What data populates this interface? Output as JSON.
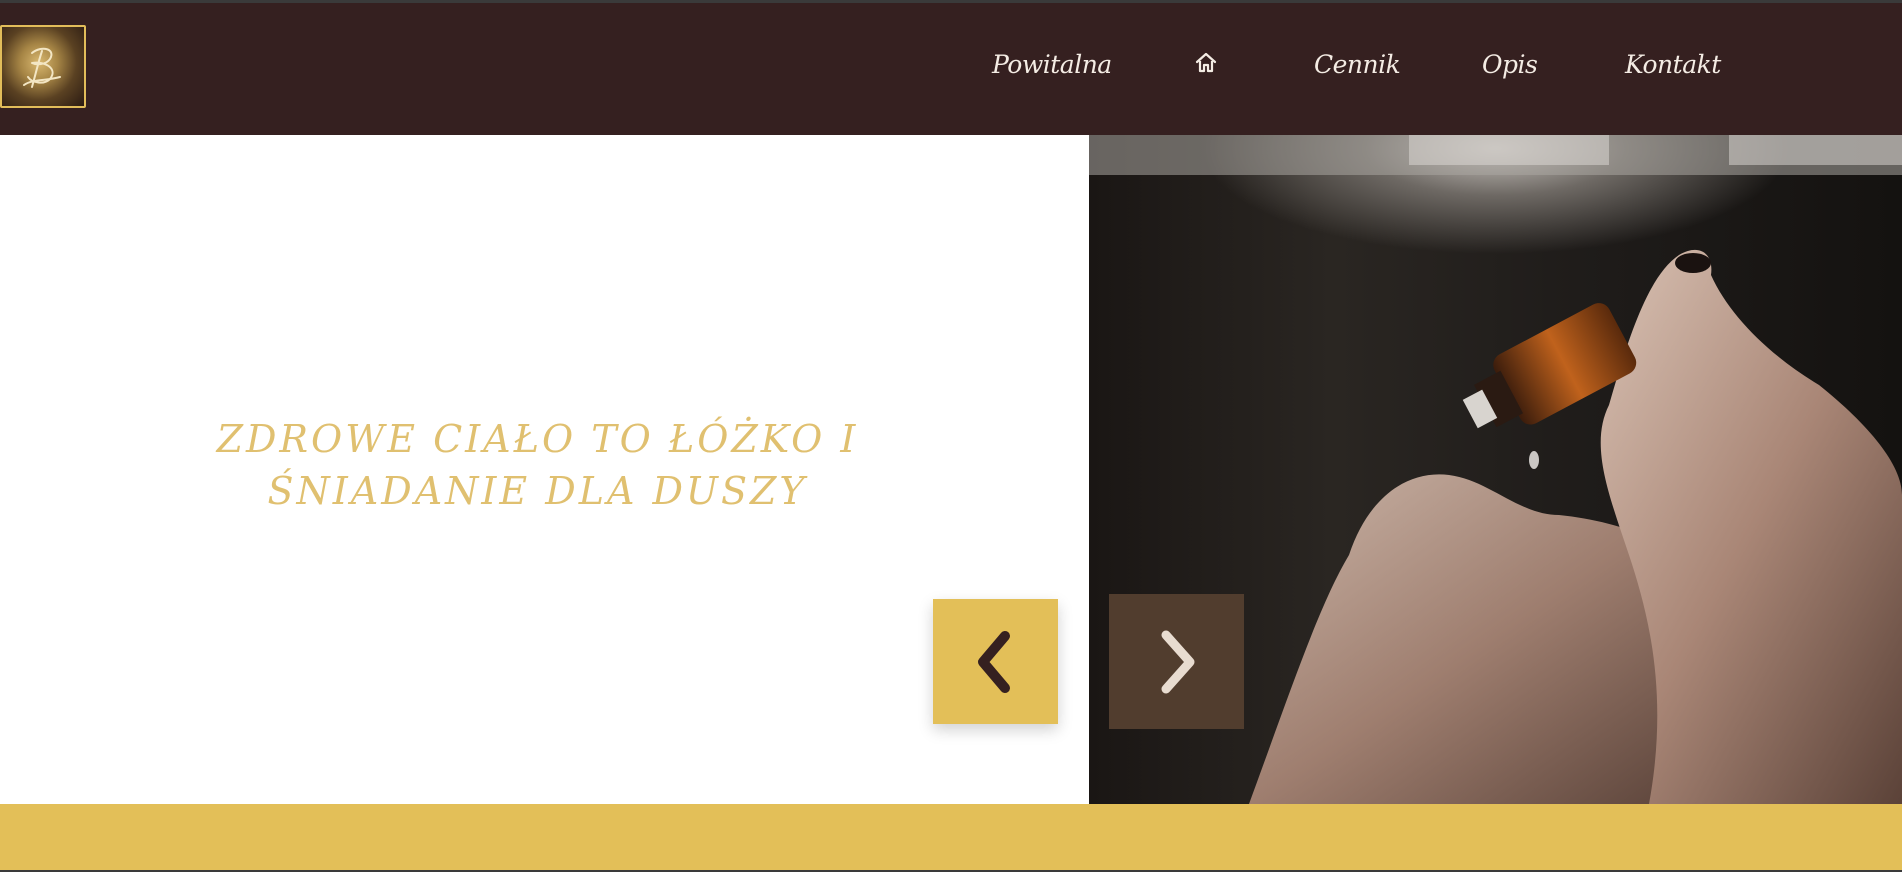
{
  "header": {
    "logo_icon": "monogram-logo",
    "nav": {
      "powitalna": "Powitalna",
      "home_icon": "home-icon",
      "cennik": "Cennik",
      "opis": "Opis",
      "kontakt": "Kontakt"
    }
  },
  "hero": {
    "tagline_line1": "ZDROWE CIAŁO TO ŁÓŻKO I",
    "tagline_line2": "ŚNIADANIE DLA DUSZY",
    "image_subject": "hands-dropping-essential-oil",
    "prev_icon": "chevron-left-icon",
    "next_icon": "chevron-right-icon"
  },
  "colors": {
    "nav_bg": "#352020",
    "gold": "#e3bf58",
    "tagline": "#e0c070",
    "next_button": "#513d2e",
    "nav_text": "#f4ece4"
  }
}
